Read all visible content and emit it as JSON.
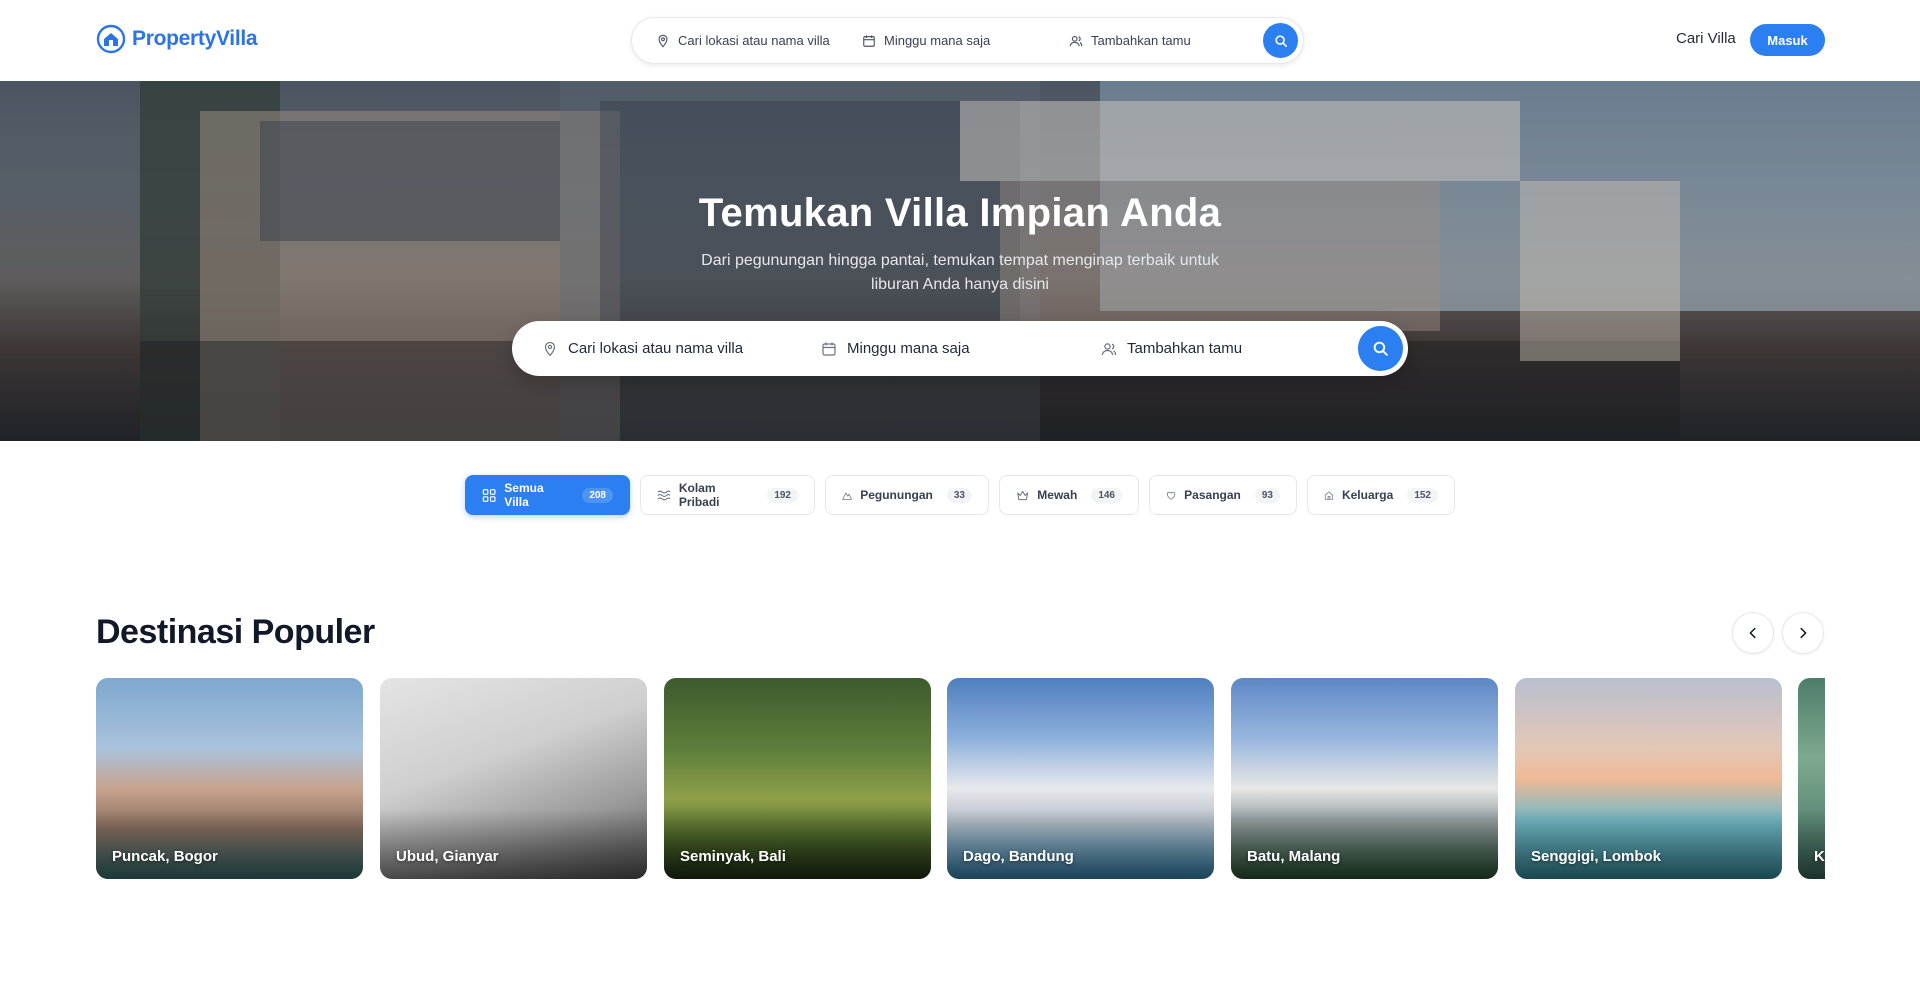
{
  "brand": {
    "name": "PropertyVilla",
    "color": "#2b74e8"
  },
  "header": {
    "search": {
      "location_placeholder": "Cari lokasi atau nama villa",
      "date_placeholder": "Minggu mana saja",
      "guests_placeholder": "Tambahkan tamu"
    },
    "nav_link": "Cari Villa",
    "login_label": "Masuk"
  },
  "hero": {
    "title": "Temukan Villa Impian Anda",
    "subtitle": "Dari pegunungan hingga pantai, temukan tempat menginap terbaik untuk liburan Anda hanya disini",
    "search": {
      "location_placeholder": "Cari lokasi atau nama villa",
      "date_placeholder": "Minggu mana saja",
      "guests_placeholder": "Tambahkan tamu"
    }
  },
  "categories": [
    {
      "label": "Semua Villa",
      "count": "208",
      "icon": "grid-icon",
      "active": true
    },
    {
      "label": "Kolam Pribadi",
      "count": "192",
      "icon": "waves-icon",
      "active": false
    },
    {
      "label": "Pegunungan",
      "count": "33",
      "icon": "mountain-icon",
      "active": false
    },
    {
      "label": "Mewah",
      "count": "146",
      "icon": "crown-icon",
      "active": false
    },
    {
      "label": "Pasangan",
      "count": "93",
      "icon": "heart-icon",
      "active": false
    },
    {
      "label": "Keluarga",
      "count": "152",
      "icon": "home-icon",
      "active": false
    }
  ],
  "destinations": {
    "title": "Destinasi Populer",
    "items": [
      {
        "name": "Puncak, Bogor"
      },
      {
        "name": "Ubud, Gianyar"
      },
      {
        "name": "Seminyak, Bali"
      },
      {
        "name": "Dago, Bandung"
      },
      {
        "name": "Batu, Malang"
      },
      {
        "name": "Senggigi, Lombok"
      },
      {
        "name": "K"
      }
    ]
  },
  "colors": {
    "accent": "#2b7ff0",
    "text": "#111827"
  }
}
